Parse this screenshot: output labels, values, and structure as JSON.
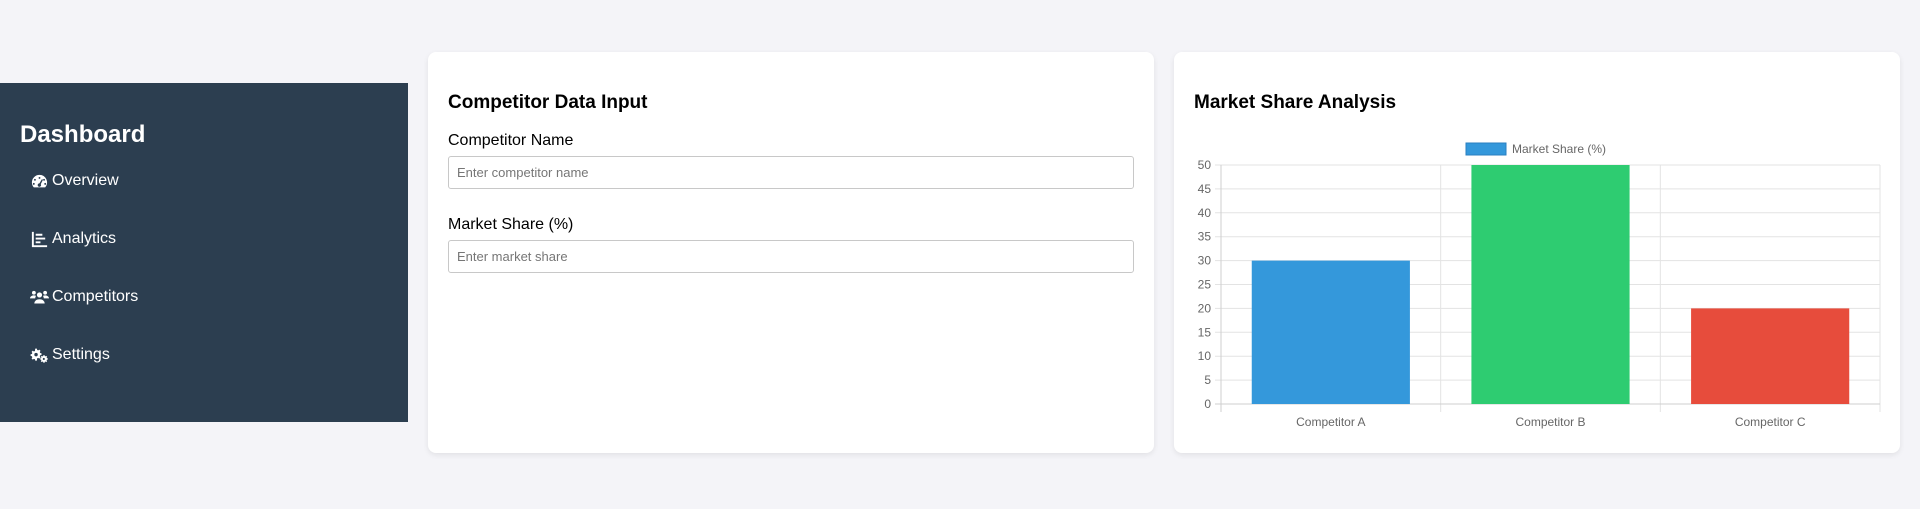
{
  "sidebar": {
    "title": "Dashboard",
    "items": [
      {
        "label": "Overview",
        "icon": "gauge-icon"
      },
      {
        "label": "Analytics",
        "icon": "chart-bar-icon"
      },
      {
        "label": "Competitors",
        "icon": "users-icon"
      },
      {
        "label": "Settings",
        "icon": "gears-icon"
      }
    ]
  },
  "input_card": {
    "title": "Competitor Data Input",
    "name_label": "Competitor Name",
    "name_placeholder": "Enter competitor name",
    "share_label": "Market Share (%)",
    "share_placeholder": "Enter market share"
  },
  "chart_card": {
    "title": "Market Share Analysis"
  },
  "chart_data": {
    "type": "bar",
    "title": "",
    "categories": [
      "Competitor A",
      "Competitor B",
      "Competitor C"
    ],
    "series": [
      {
        "name": "Market Share (%)",
        "values": [
          30,
          50,
          20
        ]
      }
    ],
    "colors": [
      "#3498db",
      "#2ecc71",
      "#e74c3c"
    ],
    "ylim": [
      0,
      50
    ],
    "yticks": [
      0,
      5,
      10,
      15,
      20,
      25,
      30,
      35,
      40,
      45,
      50
    ],
    "grid": true,
    "legend": "top"
  }
}
